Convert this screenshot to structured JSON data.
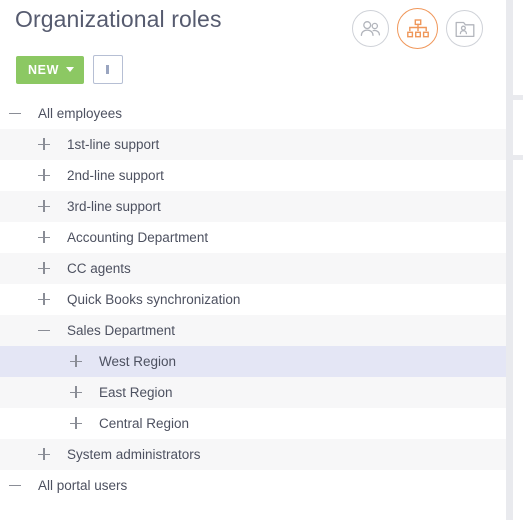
{
  "header": {
    "title": "Organizational roles",
    "icon_buttons": [
      {
        "name": "people-icon",
        "label": "Employees",
        "active": false
      },
      {
        "name": "org-chart-icon",
        "label": "Organizational roles",
        "active": true
      },
      {
        "name": "contact-card-icon",
        "label": "Contacts",
        "active": false
      }
    ]
  },
  "toolbar": {
    "new_label": "NEW",
    "kebab_label": "More actions"
  },
  "colors": {
    "accent_green": "#8cc863",
    "accent_orange": "#f0975a",
    "selected_row": "#e4e6f5",
    "alt_row": "#f7f7f8",
    "title_text": "#565b6f",
    "row_text": "#4d5160",
    "button_border": "#b6bfd4",
    "circle_border": "#cfd2d8"
  },
  "tree": {
    "rows": [
      {
        "label": "All employees",
        "level": 0,
        "state": "expanded",
        "stripe": "plain",
        "selected": false
      },
      {
        "label": "1st-line support",
        "level": 1,
        "state": "collapsed",
        "stripe": "alt",
        "selected": false
      },
      {
        "label": "2nd-line support",
        "level": 1,
        "state": "collapsed",
        "stripe": "plain",
        "selected": false
      },
      {
        "label": "3rd-line support",
        "level": 1,
        "state": "collapsed",
        "stripe": "alt",
        "selected": false
      },
      {
        "label": "Accounting Department",
        "level": 1,
        "state": "collapsed",
        "stripe": "plain",
        "selected": false
      },
      {
        "label": "CC agents",
        "level": 1,
        "state": "collapsed",
        "stripe": "alt",
        "selected": false
      },
      {
        "label": "Quick Books synchronization",
        "level": 1,
        "state": "collapsed",
        "stripe": "plain",
        "selected": false
      },
      {
        "label": "Sales Department",
        "level": 1,
        "state": "expanded",
        "stripe": "alt",
        "selected": false
      },
      {
        "label": "West Region",
        "level": 2,
        "state": "collapsed",
        "stripe": "selected",
        "selected": true
      },
      {
        "label": "East Region",
        "level": 2,
        "state": "collapsed",
        "stripe": "alt",
        "selected": false
      },
      {
        "label": "Central Region",
        "level": 2,
        "state": "collapsed",
        "stripe": "plain",
        "selected": false
      },
      {
        "label": "System administrators",
        "level": 1,
        "state": "collapsed",
        "stripe": "alt",
        "selected": false
      },
      {
        "label": "All portal users",
        "level": 0,
        "state": "expanded",
        "stripe": "plain",
        "selected": false
      }
    ]
  }
}
